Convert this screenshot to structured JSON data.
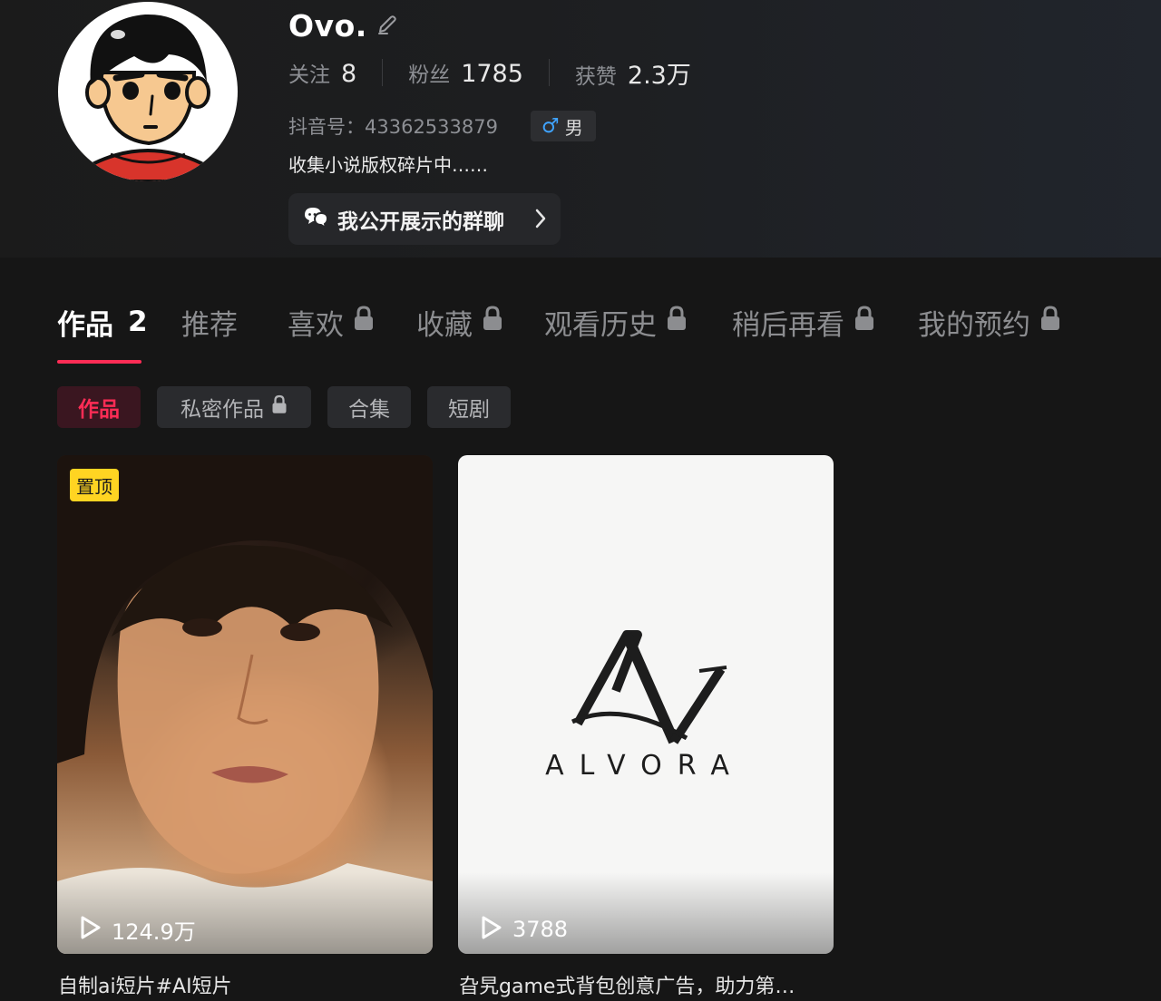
{
  "profile": {
    "nickname": "Ovo.",
    "stats": [
      {
        "label": "关注",
        "value": "8"
      },
      {
        "label": "粉丝",
        "value": "1785"
      },
      {
        "label": "获赞",
        "value": "2.3万"
      }
    ],
    "account_id": "抖音号：43362533879",
    "gender": {
      "symbol": "♂",
      "label": "男"
    },
    "bio": "收集小说版权碎片中……",
    "group_chat_label": "我公开展示的群聊"
  },
  "tabs": [
    {
      "label": "作品",
      "count": "2",
      "active": true,
      "locked": false
    },
    {
      "label": "推荐",
      "active": false,
      "locked": false
    },
    {
      "label": "喜欢",
      "active": false,
      "locked": true
    },
    {
      "label": "收藏",
      "active": false,
      "locked": true
    },
    {
      "label": "观看历史",
      "active": false,
      "locked": true
    },
    {
      "label": "稍后再看",
      "active": false,
      "locked": true
    },
    {
      "label": "我的预约",
      "active": false,
      "locked": true
    }
  ],
  "subtabs": [
    {
      "label": "作品",
      "active": true
    },
    {
      "label": "私密作品",
      "locked": true
    },
    {
      "label": "合集"
    },
    {
      "label": "短剧"
    }
  ],
  "videos": [
    {
      "pinned_label": "置顶",
      "plays": "124.9万",
      "title": "自制ai短片#AI短片"
    },
    {
      "plays": "3788",
      "title": "旮旯game式背包创意广告，助力第…",
      "logo_text": "ALVORA"
    }
  ],
  "colors": {
    "accent": "#fe2c55",
    "pin_badge": "#ffd422",
    "gender_blue": "#3fa3ff",
    "background": "#161616"
  },
  "icons": {
    "edit": "pencil-icon",
    "chat": "chat-bubbles-icon",
    "chevron": "chevron-right-icon",
    "lock": "lock-icon",
    "play": "play-icon"
  }
}
